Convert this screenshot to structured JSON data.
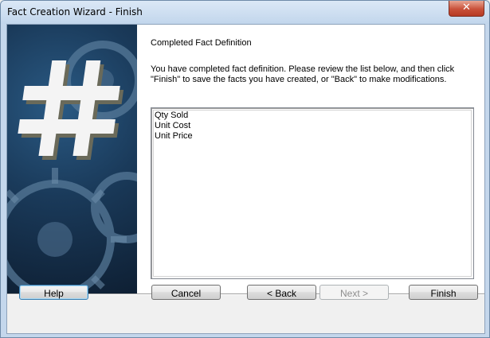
{
  "window": {
    "title": "Fact Creation Wizard - Finish",
    "close_glyph": "✕"
  },
  "page": {
    "heading": "Completed Fact Definition",
    "description": "You have completed fact definition. Please review the list below, and then click \"Finish\" to save the facts you have created, or \"Back\" to make modifications."
  },
  "facts_list": [
    "Qty Sold",
    "Unit Cost",
    "Unit Price"
  ],
  "buttons": {
    "help": "Help",
    "cancel": "Cancel",
    "back": "< Back",
    "next": "Next >",
    "finish": "Finish"
  },
  "colors": {
    "accent": "#3c7fb1",
    "image_background": "#1a3a5a"
  }
}
